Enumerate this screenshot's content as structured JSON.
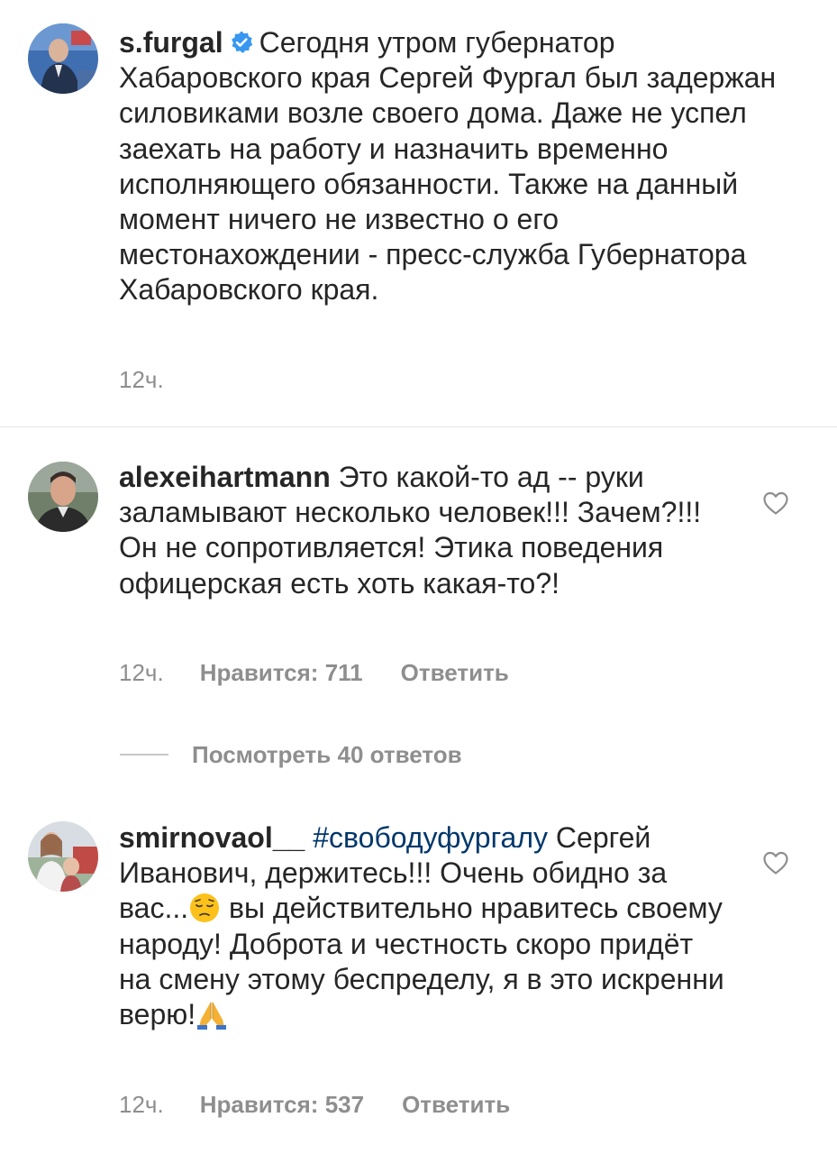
{
  "post": {
    "username": "s.furgal",
    "verified_icon": "verified-badge-icon",
    "caption": "Сегодня утром губернатор Хабаровского края Сергей Фургал был задержан силовиками возле своего дома. Даже не успел заехать на работу и назначить временно исполняющего обязанности. Также на данный момент ничего не известно о его местонахождении - пресс-служба Губернатора Хабаровского края.",
    "time": "12ч."
  },
  "comments": [
    {
      "username": "alexeihartmann",
      "text": "Это какой-то ад -- руки заламывают несколько человек!!! Зачем?!!! Он не сопротивляется! Этика поведения офицерская есть хоть какая-то?!",
      "time": "12ч.",
      "likes": "Нравится: 711",
      "reply": "Ответить",
      "view_replies": "Посмотреть 40 ответов"
    },
    {
      "username": "smirnovaol__",
      "hashtag": "#свободуфургалу",
      "text_part1": "Сергей Иванович, держитесь!!! Очень обидно за вас...",
      "emoji1": "pensive-face-emoji",
      "text_part2": "вы действительно нравитесь своему народу! Доброта и честность скоро придёт на смену этому беспределу, я в это искренни верю!",
      "emoji2": "folded-hands-emoji",
      "time": "12ч.",
      "likes": "Нравится: 537",
      "reply": "Ответить"
    }
  ],
  "colors": {
    "text": "#262626",
    "secondary": "#8e8e8e",
    "hashtag": "#00376b",
    "verified": "#3897f0",
    "divider": "#e6e6e6"
  }
}
